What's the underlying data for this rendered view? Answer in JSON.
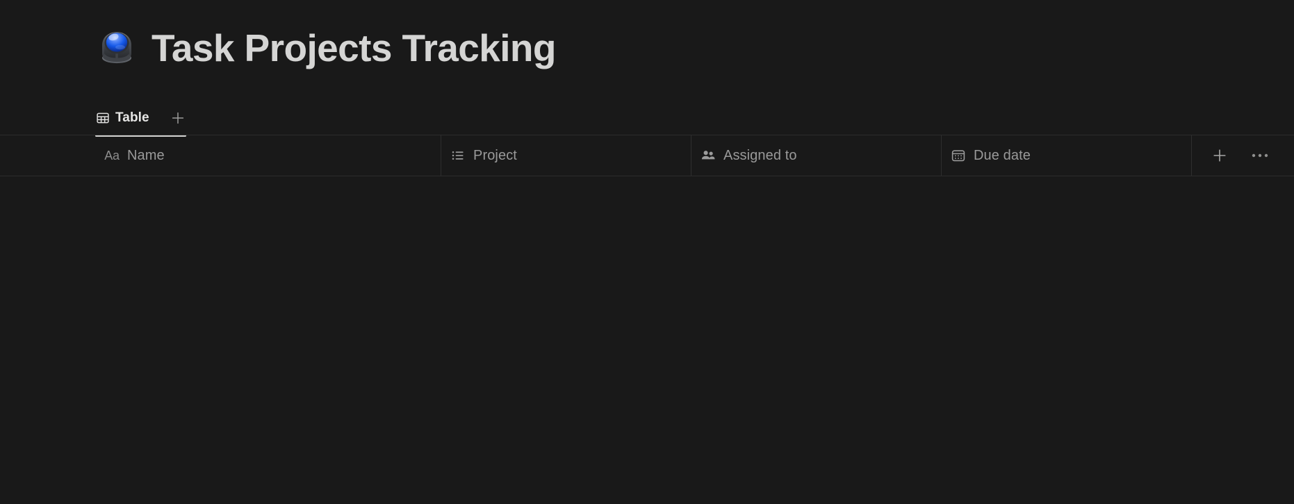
{
  "window": {
    "background_color": "#191919"
  },
  "header": {
    "emoji_name": "trackball-emoji",
    "title": "Task Projects Tracking",
    "title_color": "#d5d5d4"
  },
  "views": {
    "tabs": [
      {
        "label": "Table",
        "icon": "table-grid-icon",
        "active": true
      }
    ],
    "add_view_icon": "plus-icon",
    "active_underline_color": "#d2d2d1"
  },
  "table": {
    "columns": [
      {
        "label": "Name",
        "icon": "aa-text-icon",
        "type": "title"
      },
      {
        "label": "Project",
        "icon": "list-bullet-icon",
        "type": "relation"
      },
      {
        "label": "Assigned to",
        "icon": "people-icon",
        "type": "person"
      },
      {
        "label": "Due date",
        "icon": "calendar-icon",
        "type": "date"
      }
    ],
    "aa_glyph": "Aa",
    "add_column_icon": "plus-icon",
    "more_options_icon": "ellipsis-icon",
    "header_text_color": "#9a9a9a",
    "divider_color": "#2e2e2e",
    "rows": []
  }
}
